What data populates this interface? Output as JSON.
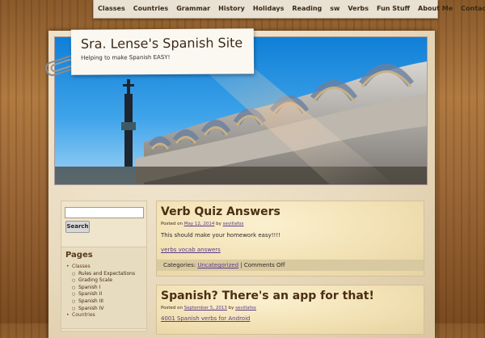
{
  "nav": {
    "items": [
      "Classes",
      "Countries",
      "Grammar",
      "History",
      "Holidays",
      "Reading",
      "sw",
      "Verbs",
      "Fun Stuff",
      "About Me",
      "Contact Me!"
    ]
  },
  "site": {
    "title": "Sra. Lense's Spanish Site",
    "tagline": "Helping to make Spanish EASY!"
  },
  "search": {
    "input_value": "",
    "button_label": "Search"
  },
  "sidebar": {
    "pages_title": "Pages",
    "pages": [
      {
        "label": "Classes",
        "level": 1
      },
      {
        "label": "Rules and Expectations",
        "level": 2
      },
      {
        "label": "Grading Scale",
        "level": 2
      },
      {
        "label": "Spanish I",
        "level": 2
      },
      {
        "label": "Spanish II",
        "level": 2
      },
      {
        "label": "Spanish III",
        "level": 2
      },
      {
        "label": "Spanish IV",
        "level": 2
      },
      {
        "label": "Countries",
        "level": 1
      }
    ]
  },
  "posts": [
    {
      "title": "Verb Quiz Answers",
      "posted_on": "Posted on",
      "date": "May 12, 2014",
      "by": "by",
      "author": "sevillafox",
      "body": "This should make your homework easy!!!!",
      "link": "verbs vocab answers",
      "categories_label": "Categories:",
      "category": "Uncategorized",
      "separator": "|",
      "comments": "Comments Off"
    },
    {
      "title": "Spanish? There's an app for that!",
      "posted_on": "Posted on",
      "date": "September 5, 2013",
      "by": "by",
      "author": "sevillafox",
      "link": "4001 Spanish verbs for Android"
    }
  ],
  "colors": {
    "wood": "#9a6636",
    "paper": "#f4ead6",
    "post_bg": "#f2e1b4",
    "title": "#4a2e12",
    "link": "#5a3a8a"
  }
}
